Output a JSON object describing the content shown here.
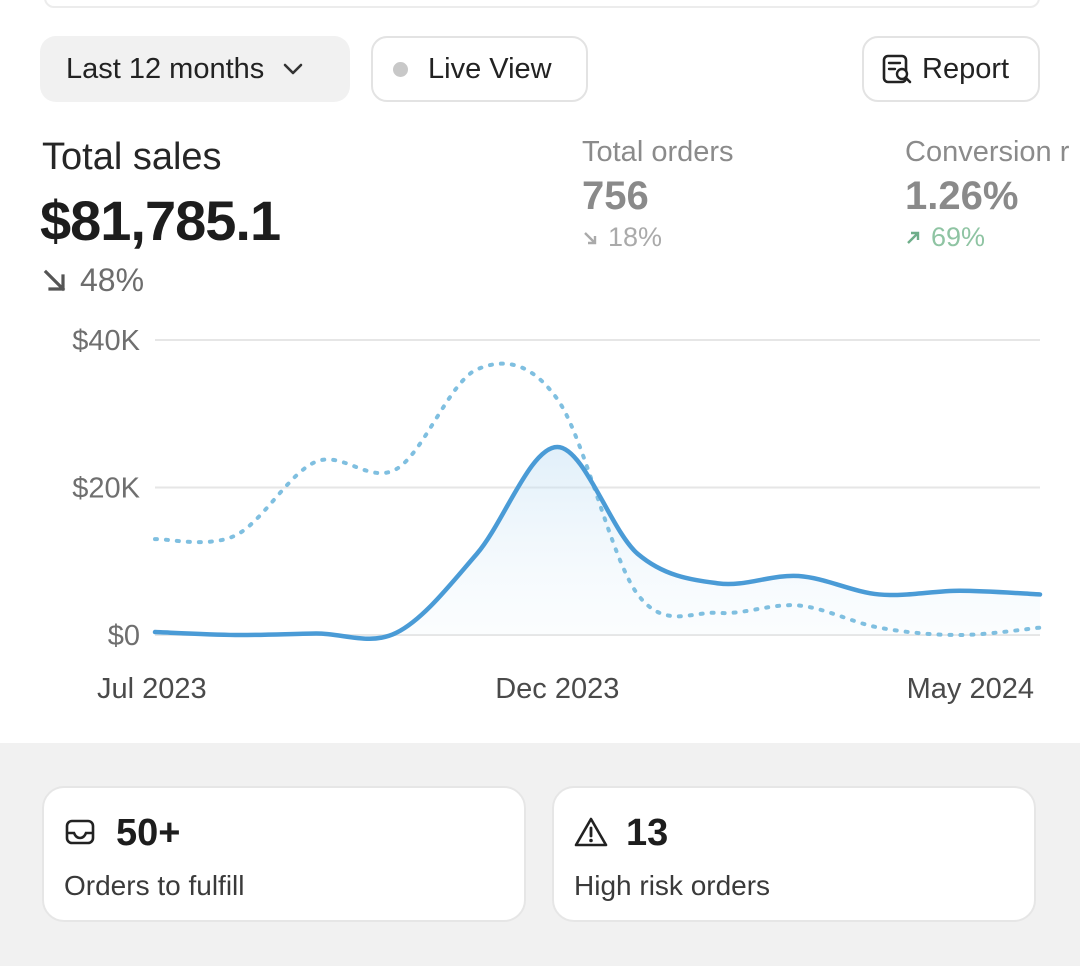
{
  "filters": {
    "period_label": "Last 12 months",
    "live_label": "Live View",
    "report_label": "Report"
  },
  "metrics": {
    "total_sales": {
      "label": "Total sales",
      "value": "$81,785.1",
      "change": "48%",
      "direction": "down"
    },
    "total_orders": {
      "label": "Total orders",
      "value": "756",
      "change": "18%",
      "direction": "down"
    },
    "conversion": {
      "label": "Conversion r",
      "value": "1.26%",
      "change": "69%",
      "direction": "up"
    }
  },
  "chart_data": {
    "type": "line",
    "x_ticks": [
      "Jul 2023",
      "Dec 2023",
      "May 2024"
    ],
    "y_ticks": [
      "$40K",
      "$20K",
      "$0"
    ],
    "ylim": [
      0,
      40000
    ],
    "x": [
      "Jul 2023",
      "Aug 2023",
      "Sep 2023",
      "Oct 2023",
      "Nov 2023",
      "Dec 2023",
      "Jan 2024",
      "Feb 2024",
      "Mar 2024",
      "Apr 2024",
      "May 2024",
      "Jun 2024"
    ],
    "series": [
      {
        "style": "solid",
        "color": "#4a9bd6",
        "values": [
          400,
          0,
          200,
          300,
          11000,
          25500,
          11000,
          7000,
          8000,
          5500,
          6000,
          5500
        ]
      },
      {
        "style": "dotted",
        "color": "#7fbfe0",
        "values": [
          13000,
          13500,
          23500,
          22500,
          36000,
          32000,
          5500,
          3000,
          4000,
          1000,
          0,
          1000
        ]
      }
    ],
    "grid": true,
    "colors": {
      "primary": "#4a9bd6",
      "comparison": "#7fbfe0",
      "grid": "#e6e6e6",
      "positive": "#6fae8a"
    }
  },
  "cards": {
    "fulfill": {
      "value": "50+",
      "label": "Orders to fulfill",
      "icon": "inbox-icon"
    },
    "risk": {
      "value": "13",
      "label": "High risk orders",
      "icon": "warning-icon"
    }
  }
}
